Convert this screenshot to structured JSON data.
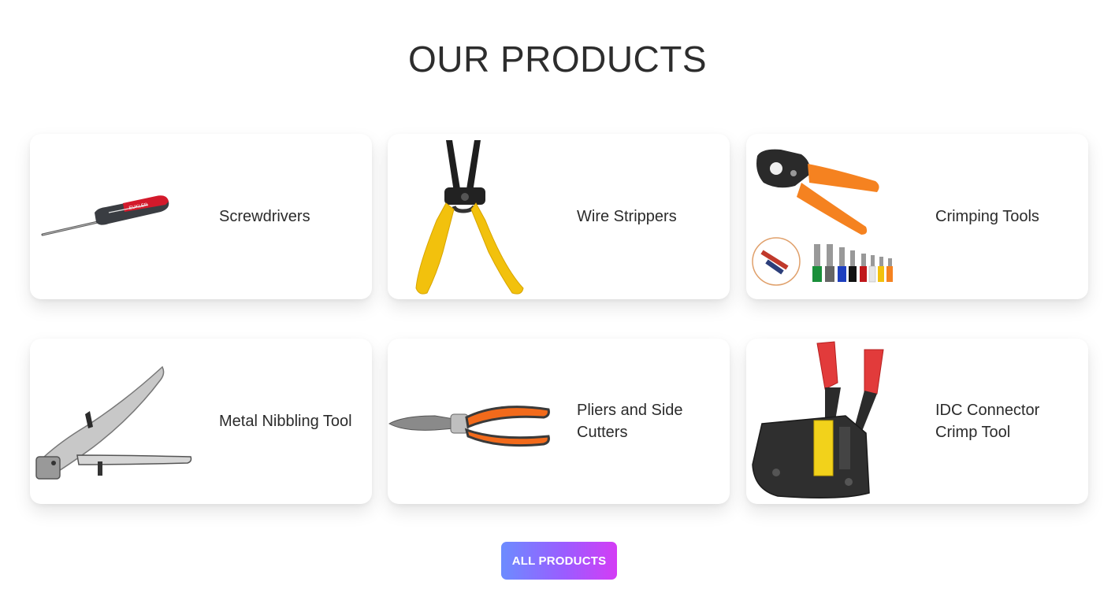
{
  "section": {
    "title": "OUR PRODUCTS"
  },
  "products": [
    {
      "label": "Screwdrivers",
      "icon": "screwdriver-icon"
    },
    {
      "label": "Wire Strippers",
      "icon": "wire-stripper-icon"
    },
    {
      "label": "Crimping Tools",
      "icon": "crimping-tool-icon"
    },
    {
      "label": "Metal Nibbling Tool",
      "icon": "nibbler-icon"
    },
    {
      "label": "Pliers and Side Cutters",
      "icon": "pliers-icon"
    },
    {
      "label": "IDC Connector Crimp Tool",
      "icon": "idc-crimp-tool-icon"
    }
  ],
  "cta": {
    "label": "ALL PRODUCTS",
    "gradient": [
      "#6c8cff",
      "#9b5cff",
      "#d43cf5"
    ]
  }
}
